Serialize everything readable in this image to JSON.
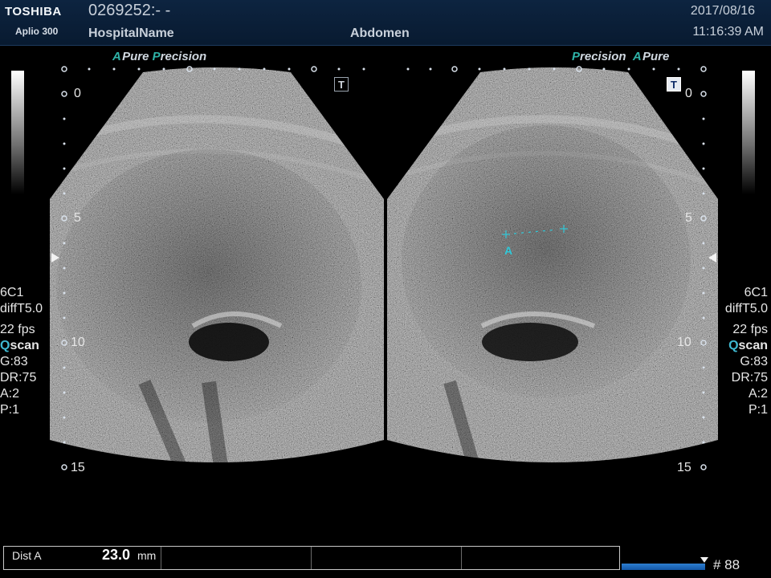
{
  "header": {
    "brand": "TOSHIBA",
    "model": "Aplio 300",
    "patient_id": "0269252:- -",
    "hospital": "HospitalName",
    "exam": "Abdomen",
    "date": "2017/08/16",
    "time": "11:16:39 AM"
  },
  "left_image": {
    "mode_label_a": "A",
    "mode_label_pure": "Pure",
    "mode_label_p": "P",
    "mode_label_precision": "recision",
    "t_button": "T",
    "t_active": false
  },
  "right_image": {
    "mode_label_p": "P",
    "mode_label_precision": "recision",
    "mode_label_a": "A",
    "mode_label_pure": "Pure",
    "t_button": "T",
    "t_active": true
  },
  "depth_scale": [
    "0",
    "5",
    "10",
    "15"
  ],
  "params": {
    "probe": "6C1",
    "preset": "diffT5.0",
    "frame_rate": "22 fps",
    "qscan_q": "Q",
    "qscan_rest": "scan",
    "gain": "G:83",
    "dynamic_range": "DR:75",
    "a": "A:2",
    "p": "P:1"
  },
  "caliper": {
    "label": "A"
  },
  "measurement": {
    "label": "Dist A",
    "value": "23.0",
    "unit": "mm"
  },
  "cine": {
    "frame_number": "# 88",
    "level": 1.0
  },
  "colors": {
    "teal": "#2fb3a8",
    "caliper": "#2fc8d8",
    "cine": "#1e6ac0",
    "header_bg": "#0a1f38"
  }
}
